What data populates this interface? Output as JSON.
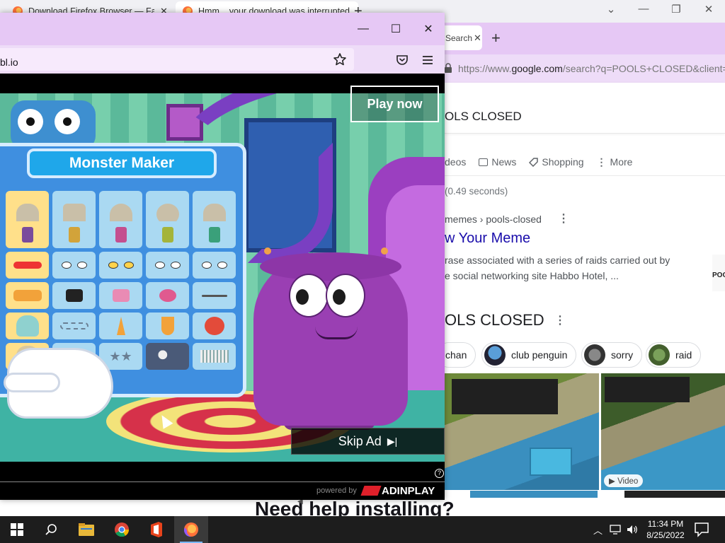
{
  "background_firefox": {
    "tabs": [
      {
        "label": "Download Firefox Browser — Fast",
        "active": false
      },
      {
        "label": "Hmm... your download was interrupted",
        "active": true
      }
    ],
    "new_tab_symbol": "+",
    "caption": {
      "minimize": "—",
      "maximize": "❐",
      "close": "✕"
    }
  },
  "google_window": {
    "tab_label": "Search",
    "tab_close": "✕",
    "new_tab_symbol": "+",
    "url_prefix": "https://www.",
    "url_domain": "google.com",
    "url_rest": "/search?q=POOLS+CLOSED&client=f",
    "query": "OLS CLOSED",
    "tabs": [
      "deos",
      "News",
      "Shopping",
      "More"
    ],
    "stats": "(0.49 seconds)",
    "result": {
      "breadcrumb": "memes › pools-closed",
      "title": "w Your Meme",
      "snippet_line1": "rase associated with a series of raids carried out by",
      "snippet_line2": "e social networking site Habbo Hotel, ..."
    },
    "thumb_cut_text": "POO",
    "section_title": "OLS CLOSED",
    "chips": [
      "chan",
      "club penguin",
      "sorry",
      "raid"
    ],
    "video_badge": "Video"
  },
  "popup": {
    "url": "bl.io",
    "caption": {
      "minimize": "—",
      "maximize": "☐",
      "close": "✕"
    },
    "ad": {
      "game_title": "Monster Maker",
      "play_button": "Play now",
      "skip_button": "Skip Ad",
      "skip_icon": "▶|",
      "help_symbol": "?",
      "powered_by": "powered by",
      "brand": "ADINPLAY"
    }
  },
  "underpage_text": "Need help installing?",
  "taskbar": {
    "time": "11:34 PM",
    "date": "8/25/2022",
    "icons": [
      "windows-start-icon",
      "search-icon",
      "file-explorer-icon",
      "chrome-icon",
      "office-icon",
      "firefox-icon"
    ]
  },
  "colors": {
    "firefox_purple": "#e6c8f5",
    "google_link": "#1a0dab",
    "taskbar": "#1d1d1d"
  }
}
